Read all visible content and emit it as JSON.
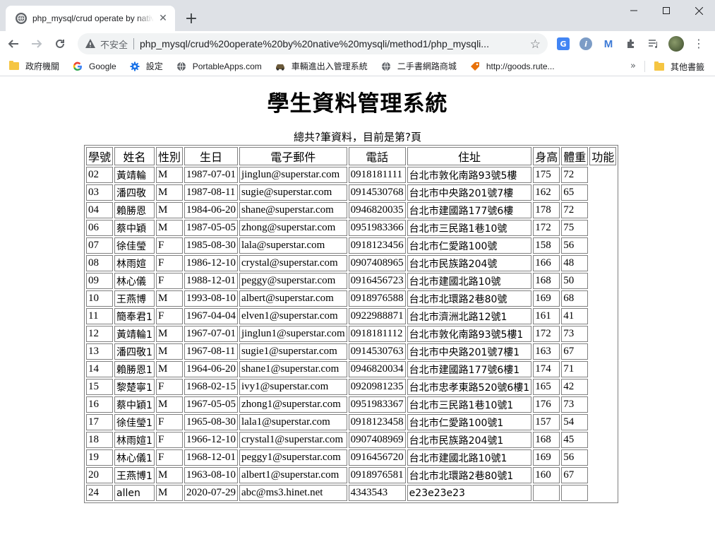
{
  "browser": {
    "tab_title": "php_mysql/crud operate by native",
    "url_insecure_label": "不安全",
    "url": "php_mysql/crud%20operate%20by%20native%20mysqli/method1/php_mysqli...",
    "bookmarks": [
      {
        "label": "政府機關",
        "icon": "folder-icon"
      },
      {
        "label": "Google",
        "icon": "google-icon"
      },
      {
        "label": "設定",
        "icon": "gear-icon"
      },
      {
        "label": "PortableApps.com",
        "icon": "globe-icon"
      },
      {
        "label": "車輛進出入管理系統",
        "icon": "car-icon"
      },
      {
        "label": "二手書網路商城",
        "icon": "globe-icon"
      },
      {
        "label": "http://goods.rute...",
        "icon": "tag-icon"
      }
    ],
    "other_bookmarks": "其他書籤"
  },
  "page": {
    "title": "學生資料管理系統",
    "summary": "總共?筆資料，目前是第?頁"
  },
  "table": {
    "headers": [
      "學號",
      "姓名",
      "性別",
      "生日",
      "電子郵件",
      "電話",
      "住址",
      "身高",
      "體重",
      "功能"
    ],
    "rows": [
      [
        "02",
        "黃靖輪",
        "M",
        "1987-07-01",
        "jinglun@superstar.com",
        "0918181111",
        "台北市敦化南路93號5樓",
        "175",
        "72"
      ],
      [
        "03",
        "潘四敬",
        "M",
        "1987-08-11",
        "sugie@superstar.com",
        "0914530768",
        "台北市中央路201號7樓",
        "162",
        "65"
      ],
      [
        "04",
        "賴勝恩",
        "M",
        "1984-06-20",
        "shane@superstar.com",
        "0946820035",
        "台北市建國路177號6樓",
        "178",
        "72"
      ],
      [
        "06",
        "蔡中穎",
        "M",
        "1987-05-05",
        "zhong@superstar.com",
        "0951983366",
        "台北市三民路1巷10號",
        "172",
        "75"
      ],
      [
        "07",
        "徐佳瑩",
        "F",
        "1985-08-30",
        "lala@superstar.com",
        "0918123456",
        "台北市仁愛路100號",
        "158",
        "56"
      ],
      [
        "08",
        "林雨媗",
        "F",
        "1986-12-10",
        "crystal@superstar.com",
        "0907408965",
        "台北市民族路204號",
        "166",
        "48"
      ],
      [
        "09",
        "林心儀",
        "F",
        "1988-12-01",
        "peggy@superstar.com",
        "0916456723",
        "台北市建國北路10號",
        "168",
        "50"
      ],
      [
        "10",
        "王燕博",
        "M",
        "1993-08-10",
        "albert@superstar.com",
        "0918976588",
        "台北市北環路2巷80號",
        "169",
        "68"
      ],
      [
        "11",
        "簡奉君1",
        "F",
        "1967-04-04",
        "elven1@superstar.com",
        "0922988871",
        "台北市濟洲北路12號1",
        "161",
        "41"
      ],
      [
        "12",
        "黃靖輪1",
        "M",
        "1967-07-01",
        "jinglun1@superstar.com",
        "0918181112",
        "台北市敦化南路93號5樓1",
        "172",
        "73"
      ],
      [
        "13",
        "潘四敬1",
        "M",
        "1967-08-11",
        "sugie1@superstar.com",
        "0914530763",
        "台北市中央路201號7樓1",
        "163",
        "67"
      ],
      [
        "14",
        "賴勝恩1",
        "M",
        "1964-06-20",
        "shane1@superstar.com",
        "0946820034",
        "台北市建國路177號6樓1",
        "174",
        "71"
      ],
      [
        "15",
        "黎楚寧1",
        "F",
        "1968-02-15",
        "ivy1@superstar.com",
        "0920981235",
        "台北市忠孝東路520號6樓1",
        "165",
        "42"
      ],
      [
        "16",
        "蔡中穎1",
        "M",
        "1967-05-05",
        "zhong1@superstar.com",
        "0951983367",
        "台北市三民路1巷10號1",
        "176",
        "73"
      ],
      [
        "17",
        "徐佳瑩1",
        "F",
        "1965-08-30",
        "lala1@superstar.com",
        "0918123458",
        "台北市仁愛路100號1",
        "157",
        "54"
      ],
      [
        "18",
        "林雨媗1",
        "F",
        "1966-12-10",
        "crystal1@superstar.com",
        "0907408969",
        "台北市民族路204號1",
        "168",
        "45"
      ],
      [
        "19",
        "林心儀1",
        "F",
        "1968-12-01",
        "peggy1@superstar.com",
        "0916456720",
        "台北市建國北路10號1",
        "169",
        "56"
      ],
      [
        "20",
        "王燕博1",
        "M",
        "1963-08-10",
        "albert1@superstar.com",
        "0918976581",
        "台北市北環路2巷80號1",
        "160",
        "67"
      ],
      [
        "24",
        "allen",
        "M",
        "2020-07-29",
        "abc@ms3.hinet.net",
        "4343543",
        "e23e23e23",
        "",
        ""
      ]
    ]
  }
}
